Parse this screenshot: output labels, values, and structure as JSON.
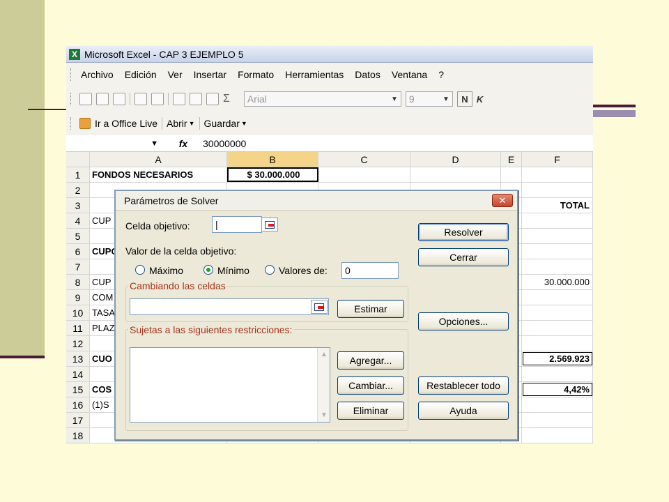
{
  "window": {
    "title": "Microsoft Excel - CAP 3 EJEMPLO 5"
  },
  "menu": [
    "Archivo",
    "Edición",
    "Ver",
    "Insertar",
    "Formato",
    "Herramientas",
    "Datos",
    "Ventana",
    "?"
  ],
  "toolbar": {
    "sigma": "Σ",
    "font_name": "Arial",
    "font_size": "9",
    "bold_label": "N",
    "italic_label": "K",
    "office_live": "Ir a Office Live",
    "open_label": "Abrir",
    "save_label": "Guardar"
  },
  "formula_bar": {
    "fx": "fx",
    "value": "30000000"
  },
  "grid": {
    "columns": [
      "A",
      "B",
      "C",
      "D",
      "E",
      "F"
    ],
    "rows": [
      {
        "n": "1",
        "a": "FONDOS NECESARIOS",
        "b": "$ 30.000.000",
        "f": ""
      },
      {
        "n": "2",
        "a": "",
        "b": "",
        "f": ""
      },
      {
        "n": "3",
        "a": "",
        "b": "",
        "f": "TOTAL"
      },
      {
        "n": "4",
        "a": "CUP",
        "b": "",
        "f": ""
      },
      {
        "n": "5",
        "a": "",
        "b": "",
        "f": ""
      },
      {
        "n": "6",
        "a": "CUPO",
        "b": "",
        "f": ""
      },
      {
        "n": "7",
        "a": "",
        "b": "",
        "f": ""
      },
      {
        "n": "8",
        "a": "CUP",
        "b": "",
        "f": "30.000.000"
      },
      {
        "n": "9",
        "a": "COM",
        "b": "",
        "f": ""
      },
      {
        "n": "10",
        "a": "TASA",
        "b": "",
        "f": ""
      },
      {
        "n": "11",
        "a": "PLAZ",
        "b": "",
        "f": ""
      },
      {
        "n": "12",
        "a": "",
        "b": "",
        "f": ""
      },
      {
        "n": "13",
        "a": "CUO",
        "b": "",
        "f": "2.569.923"
      },
      {
        "n": "14",
        "a": "",
        "b": "",
        "f": ""
      },
      {
        "n": "15",
        "a": "COS",
        "b": "",
        "f": "4,42%"
      },
      {
        "n": "16",
        "a": "(1)S",
        "b": "",
        "f": ""
      },
      {
        "n": "17",
        "a": "",
        "b": "",
        "f": ""
      },
      {
        "n": "18",
        "a": "",
        "b": "",
        "f": ""
      }
    ]
  },
  "solver": {
    "title": "Parámetros de Solver",
    "target_cell_label": "Celda objetivo:",
    "target_value_label": "Valor de la celda objetivo:",
    "max_label": "Máximo",
    "min_label": "Mínimo",
    "value_of_label": "Valores de:",
    "value_of_value": "0",
    "changing_cells_label": "Cambiando las celdas",
    "constraints_label": "Sujetas a las siguientes restricciones:",
    "buttons": {
      "solve": "Resolver",
      "close": "Cerrar",
      "guess": "Estimar",
      "options": "Opciones...",
      "add": "Agregar...",
      "change": "Cambiar...",
      "delete": "Eliminar",
      "reset": "Restablecer todo",
      "help": "Ayuda"
    },
    "close_icon": "✕"
  }
}
